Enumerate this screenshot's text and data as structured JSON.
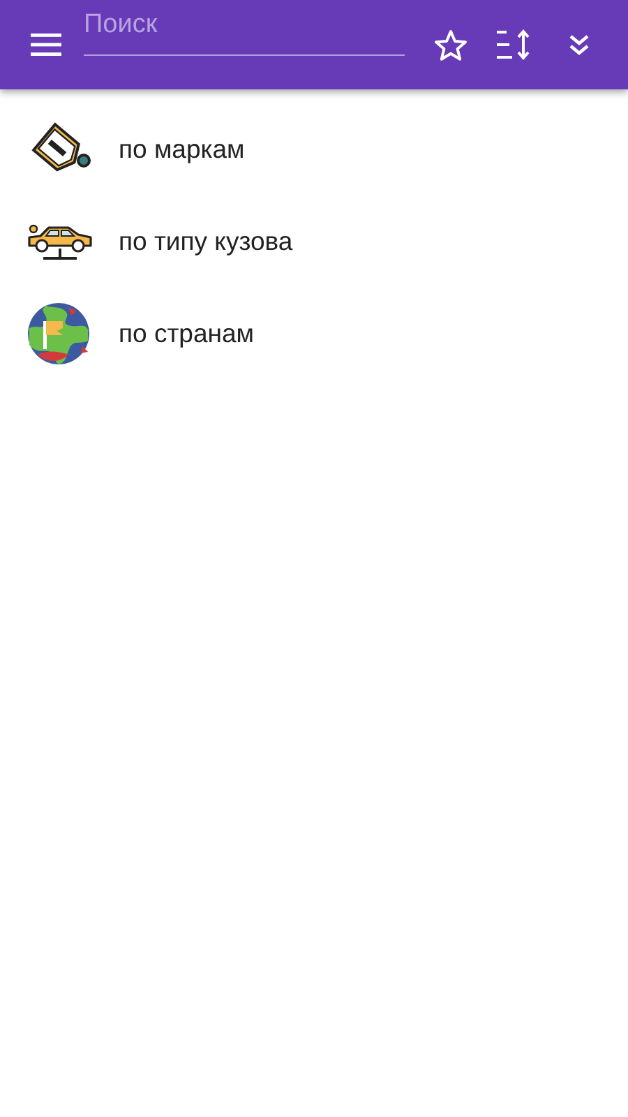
{
  "toolbar": {
    "search": {
      "placeholder": "Поиск"
    }
  },
  "items": [
    {
      "label": "по маркам",
      "kind": "brand"
    },
    {
      "label": "по типу кузова",
      "kind": "body"
    },
    {
      "label": "по странам",
      "kind": "country"
    }
  ]
}
